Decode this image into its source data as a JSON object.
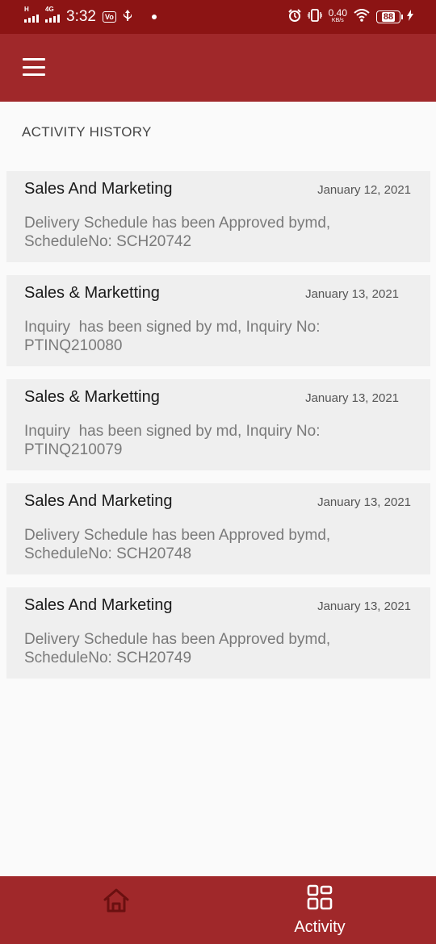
{
  "status_bar": {
    "time": "3:32",
    "network_tag_1": "H",
    "network_tag_2": "4G",
    "vo_badge": "Vo",
    "usb_icon": "usb-icon",
    "speed_value": "0.40",
    "speed_unit": "KB/s",
    "battery_level": "88",
    "colors": {
      "background": "#8c1414",
      "text": "#ffffff"
    }
  },
  "app_bar": {
    "menu_icon": "hamburger-menu-icon",
    "colors": {
      "background": "#a0282a"
    }
  },
  "page": {
    "title": "ACTIVITY HISTORY"
  },
  "activities": [
    {
      "title": "Sales And Marketing",
      "date": "January 12, 2021",
      "description": "Delivery Schedule has been Approved bymd,\nScheduleNo: SCH20742"
    },
    {
      "title": "Sales & Marketting",
      "date": "January 13, 2021",
      "description": "Inquiry  has been signed by md, Inquiry No:\nPTINQ210080"
    },
    {
      "title": "Sales & Marketting",
      "date": "January 13, 2021",
      "description": "Inquiry  has been signed by md, Inquiry No:\nPTINQ210079"
    },
    {
      "title": "Sales And Marketing",
      "date": "January 13, 2021",
      "description": "Delivery Schedule has been Approved bymd,\nScheduleNo: SCH20748"
    },
    {
      "title": "Sales And Marketing",
      "date": "January 13, 2021",
      "description": "Delivery Schedule has been Approved bymd,\nScheduleNo: SCH20749"
    }
  ],
  "bottom_nav": {
    "home_icon": "home-icon",
    "activity_icon": "grid-icon",
    "activity_label": "Activity",
    "colors": {
      "background": "#a0282a",
      "home_icon": "#6a1010",
      "activity_icon": "#ffffff"
    }
  }
}
